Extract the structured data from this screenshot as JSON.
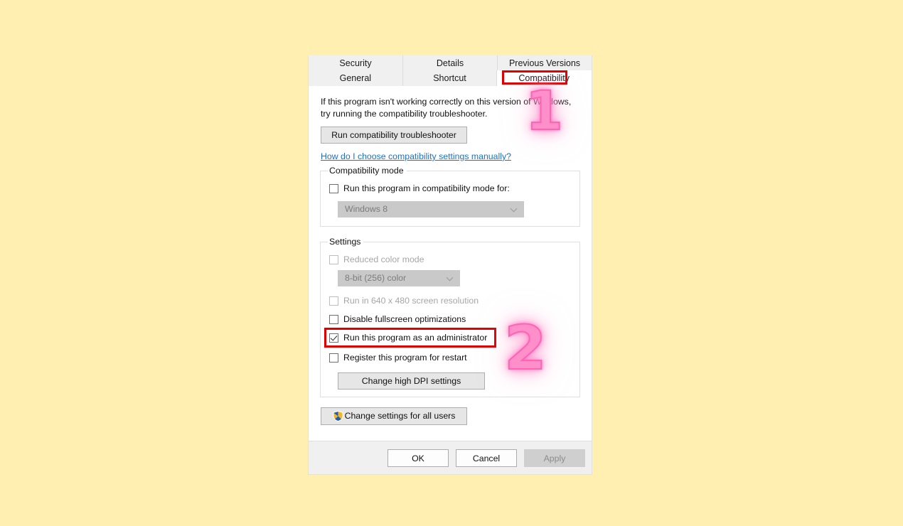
{
  "page": {
    "background_color": "#FFEFB0"
  },
  "dialog": {
    "tabs_row1": [
      {
        "label": "Security",
        "active": false
      },
      {
        "label": "Details",
        "active": false
      },
      {
        "label": "Previous Versions",
        "active": false
      }
    ],
    "tabs_row2": [
      {
        "label": "General",
        "active": false
      },
      {
        "label": "Shortcut",
        "active": false
      },
      {
        "label": "Compatibility",
        "active": true
      }
    ],
    "intro_text": "If this program isn't working correctly on this version of Windows, try running the compatibility troubleshooter.",
    "run_troubleshooter_label": "Run compatibility troubleshooter",
    "help_link_label": "How do I choose compatibility settings manually?",
    "compatibility_mode": {
      "legend": "Compatibility mode",
      "checkbox_label": "Run this program in compatibility mode for:",
      "checkbox_checked": false,
      "combo_value": "Windows 8",
      "combo_disabled": true
    },
    "settings": {
      "legend": "Settings",
      "reduced_color_mode": {
        "label": "Reduced color mode",
        "checked": false,
        "disabled": true
      },
      "color_depth_combo": {
        "value": "8-bit (256) color",
        "disabled": true
      },
      "rows": [
        {
          "label": "Run in 640 x 480 screen resolution",
          "checked": false,
          "disabled": true
        },
        {
          "label": "Disable fullscreen optimizations",
          "checked": false,
          "disabled": false
        },
        {
          "label": "Run this program as an administrator",
          "checked": true,
          "disabled": false
        },
        {
          "label": "Register this program for restart",
          "checked": false,
          "disabled": false
        }
      ],
      "change_dpi_label": "Change high DPI settings"
    },
    "change_all_users_label": "Change settings for all users",
    "footer": {
      "ok_label": "OK",
      "cancel_label": "Cancel",
      "apply_label": "Apply",
      "apply_disabled": true
    }
  },
  "annotations": {
    "highlight_color": "#E00000",
    "marker_color": "#FF8FCB",
    "step_one": "1",
    "step_two": "2"
  }
}
